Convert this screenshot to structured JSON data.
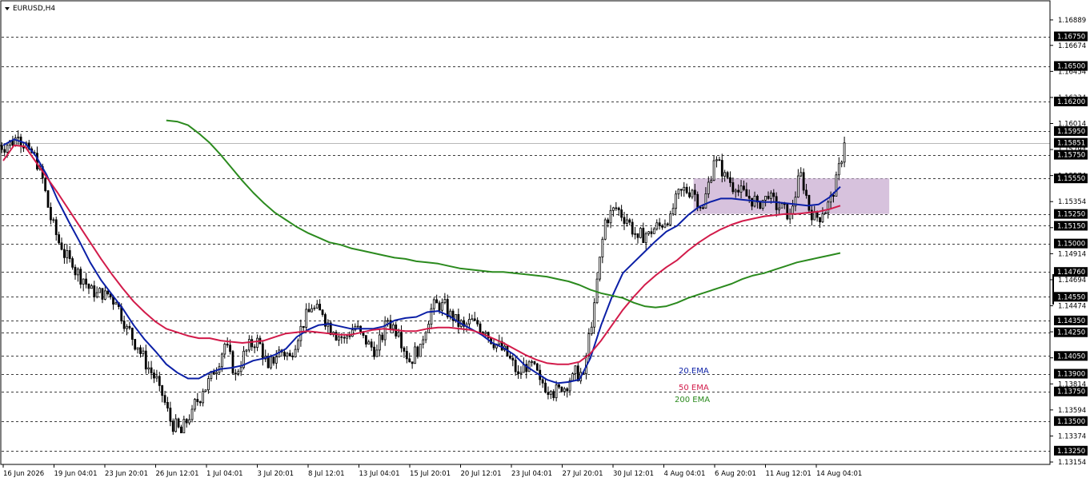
{
  "window": {
    "title": "EURUSD,H4"
  },
  "chart_data": {
    "type": "line",
    "title": "EURUSD,H4",
    "ylim": [
      1.13154,
      1.16929
    ],
    "y_ticks": [
      "1.16889",
      "1.16674",
      "1.16454",
      "1.16234",
      "1.16014",
      "1.15794",
      "1.15574",
      "1.15354",
      "1.15134",
      "1.14914",
      "1.14694",
      "1.14474",
      "1.14254",
      "1.14034",
      "1.13814",
      "1.13594",
      "1.13374",
      "1.13154"
    ],
    "x_ticks": [
      "16 Jun 2026",
      "19 Jun 04:01",
      "23 Jun 20:01",
      "26 Jun 12:01",
      "1 Jul 04:01",
      "3 Jul 20:01",
      "8 Jul 12:01",
      "13 Jul 04:01",
      "15 Jul 20:01",
      "20 Jul 12:01",
      "23 Jul 04:01",
      "27 Jul 20:01",
      "30 Jul 12:01",
      "4 Aug 04:01",
      "6 Aug 20:01",
      "11 Aug 12:01",
      "14 Aug 04:01"
    ],
    "levels": [
      {
        "value": 1.1675,
        "label": "1.16750"
      },
      {
        "value": 1.165,
        "label": "1.16500"
      },
      {
        "value": 1.162,
        "label": "1.16200"
      },
      {
        "value": 1.1595,
        "label": "1.15950"
      },
      {
        "value": 1.1575,
        "label": "1.15750"
      },
      {
        "value": 1.1555,
        "label": "1.15550"
      },
      {
        "value": 1.1525,
        "label": "1.15250"
      },
      {
        "value": 1.1515,
        "label": "1.15150"
      },
      {
        "value": 1.15,
        "label": "1.15000"
      },
      {
        "value": 1.1476,
        "label": "1.14760"
      },
      {
        "value": 1.1455,
        "label": "1.14550"
      },
      {
        "value": 1.1435,
        "label": "1.14350"
      },
      {
        "value": 1.1425,
        "label": "1.14250"
      },
      {
        "value": 1.1405,
        "label": "1.14050"
      },
      {
        "value": 1.139,
        "label": "1.13900"
      },
      {
        "value": 1.1375,
        "label": "1.13750"
      },
      {
        "value": 1.135,
        "label": "1.13500"
      },
      {
        "value": 1.1325,
        "label": "1.13250"
      }
    ],
    "current_price": {
      "value": 1.15851,
      "label": "1.15851"
    },
    "zone": {
      "from_index": 63.5,
      "to_index": 81.5,
      "low": 1.1525,
      "high": 1.1555
    },
    "series": [
      {
        "name": "20.EMA",
        "color": "#0b1fa6",
        "values": [
          1.1583,
          1.1588,
          1.1585,
          1.1574,
          1.1558,
          1.1537,
          1.1519,
          1.1502,
          1.1484,
          1.1469,
          1.1457,
          1.1445,
          1.1431,
          1.1419,
          1.1409,
          1.1398,
          1.1391,
          1.1386,
          1.1386,
          1.1391,
          1.1394,
          1.1395,
          1.1397,
          1.1401,
          1.1403,
          1.1406,
          1.1411,
          1.1421,
          1.1427,
          1.1431,
          1.1432,
          1.143,
          1.1428,
          1.1428,
          1.1428,
          1.143,
          1.1435,
          1.1437,
          1.1438,
          1.1442,
          1.1443,
          1.1439,
          1.1433,
          1.1428,
          1.1423,
          1.1416,
          1.1412,
          1.1406,
          1.1397,
          1.1391,
          1.1385,
          1.1382,
          1.1383,
          1.1385,
          1.1403,
          1.1431,
          1.1455,
          1.1475,
          1.1484,
          1.1493,
          1.1502,
          1.151,
          1.1515,
          1.1524,
          1.1531,
          1.1535,
          1.1538,
          1.1538,
          1.1537,
          1.1536,
          1.1535,
          1.1535,
          1.1534,
          1.1533,
          1.1532,
          1.1533,
          1.1539,
          1.1548
        ]
      },
      {
        "name": "50 EMA",
        "color": "#d21b4a",
        "values": [
          1.157,
          1.1583,
          1.1582,
          1.1569,
          1.1556,
          1.1543,
          1.1529,
          1.1515,
          1.1501,
          1.1487,
          1.1474,
          1.1462,
          1.1451,
          1.1442,
          1.1434,
          1.1428,
          1.1425,
          1.1422,
          1.142,
          1.142,
          1.1418,
          1.1417,
          1.1416,
          1.1417,
          1.1418,
          1.1421,
          1.1424,
          1.1425,
          1.1426,
          1.1425,
          1.1424,
          1.1423,
          1.1423,
          1.1425,
          1.1427,
          1.1428,
          1.1427,
          1.1426,
          1.1426,
          1.1428,
          1.1429,
          1.1429,
          1.1428,
          1.1427,
          1.1424,
          1.142,
          1.1416,
          1.1411,
          1.1406,
          1.1402,
          1.1399,
          1.1398,
          1.1398,
          1.14,
          1.1407,
          1.1418,
          1.1431,
          1.1444,
          1.1455,
          1.1465,
          1.1473,
          1.148,
          1.1486,
          1.1494,
          1.1501,
          1.1507,
          1.1512,
          1.1516,
          1.1519,
          1.1521,
          1.1523,
          1.1524,
          1.1525,
          1.1525,
          1.1526,
          1.1527,
          1.1529,
          1.1532
        ]
      },
      {
        "name": "200 EMA",
        "color": "#2b8a1e",
        "values": [
          1.1604,
          1.1603,
          1.16,
          1.1593,
          1.1585,
          1.1575,
          1.1564,
          1.1553,
          1.1543,
          1.1534,
          1.1526,
          1.152,
          1.1514,
          1.1509,
          1.1505,
          1.1501,
          1.1499,
          1.1496,
          1.1494,
          1.1492,
          1.149,
          1.1488,
          1.1487,
          1.1485,
          1.1484,
          1.1483,
          1.1481,
          1.1479,
          1.1478,
          1.1477,
          1.1476,
          1.1476,
          1.1475,
          1.1474,
          1.1473,
          1.1472,
          1.147,
          1.1468,
          1.1465,
          1.1461,
          1.1458,
          1.1456,
          1.1454,
          1.145,
          1.1447,
          1.1446,
          1.1447,
          1.145,
          1.1454,
          1.1457,
          1.146,
          1.1463,
          1.1466,
          1.147,
          1.1473,
          1.1475,
          1.1478,
          1.1481,
          1.1484,
          1.1486,
          1.1488,
          1.149,
          1.1492
        ]
      }
    ],
    "legend": [
      {
        "label": "20.EMA",
        "color": "#0b1fa6"
      },
      {
        "label": "50 EMA",
        "color": "#d21b4a"
      },
      {
        "label": "200 EMA",
        "color": "#2b8a1e"
      }
    ],
    "closes": [
      1.1583,
      1.159,
      1.158,
      1.1565,
      1.152,
      1.1495,
      1.148,
      1.147,
      1.1455,
      1.146,
      1.145,
      1.143,
      1.1412,
      1.1395,
      1.138,
      1.135,
      1.134,
      1.136,
      1.1375,
      1.139,
      1.1415,
      1.139,
      1.141,
      1.142,
      1.1395,
      1.141,
      1.1405,
      1.143,
      1.1445,
      1.144,
      1.1425,
      1.142,
      1.143,
      1.1415,
      1.141,
      1.1435,
      1.1425,
      1.14,
      1.1415,
      1.1445,
      1.145,
      1.1435,
      1.143,
      1.1435,
      1.1425,
      1.1415,
      1.1405,
      1.139,
      1.14,
      1.1385,
      1.1375,
      1.1375,
      1.139,
      1.139,
      1.145,
      1.152,
      1.153,
      1.152,
      1.1505,
      1.151,
      1.1515,
      1.1525,
      1.1545,
      1.1545,
      1.153,
      1.157,
      1.156,
      1.1545,
      1.154,
      1.1535,
      1.1538,
      1.153,
      1.1525,
      1.156,
      1.152,
      1.1525,
      1.154,
      1.1585
    ]
  }
}
